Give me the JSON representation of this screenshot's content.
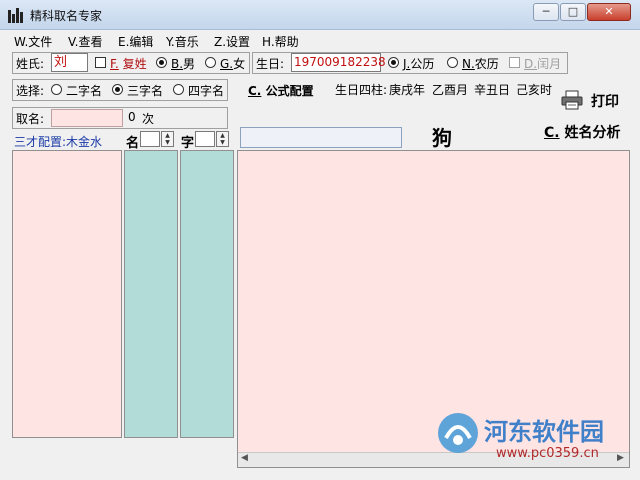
{
  "window": {
    "title": "精科取名专家",
    "min": "─",
    "max": "□",
    "close": "✕"
  },
  "menu": [
    "W.文件",
    "V.查看",
    "E.编辑",
    "Y.音乐",
    "Z.设置",
    "H.帮助"
  ],
  "row1": {
    "surname_label": "姓氏:",
    "surname_value": "刘",
    "compound_hotkey": "F.",
    "compound_label": "复姓",
    "male_hotkey": "B.",
    "male_label": "男",
    "female_hotkey": "G.",
    "female_label": "女",
    "birth_label": "生日:",
    "birth_value": "197009182238",
    "solar_hotkey": "J.",
    "solar_label": "公历",
    "lunar_hotkey": "N.",
    "lunar_label": "农历",
    "leap_hotkey": "D.",
    "leap_label": "闰月"
  },
  "row2": {
    "select_label": "选择:",
    "opt_two": "二字名",
    "opt_three": "三字名",
    "opt_four": "四字名",
    "formula_hotkey": "C.",
    "formula_label": "公式配置",
    "bazi_label": "生日四柱:",
    "bazi_year": "庚戌年",
    "bazi_month": "乙酉月",
    "bazi_day": "辛丑日",
    "bazi_hour": "己亥时",
    "print_label": "打印"
  },
  "row3": {
    "naming_label": "取名:",
    "count_value": "0",
    "count_unit": "次",
    "zodiac": "狗",
    "analysis_hotkey": "C.",
    "analysis_label": "姓名分析"
  },
  "row4": {
    "sancai_label": "三才配置:",
    "sancai_value": "木金水",
    "ming_label": "名",
    "zi_label": "字"
  },
  "colors": {
    "pink": "#ffe4e4",
    "teal": "#b2dcd8",
    "accent_red": "#b01010"
  },
  "watermark": {
    "text": "河东软件园",
    "url": "www.pc0359.cn"
  }
}
